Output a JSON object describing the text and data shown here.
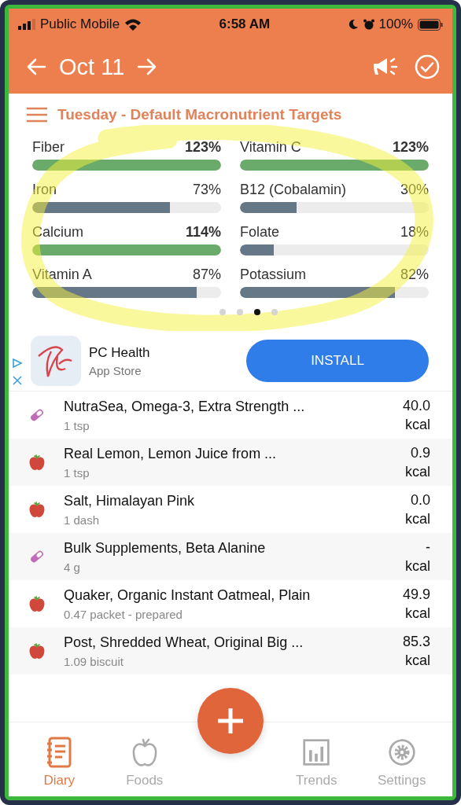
{
  "status_bar": {
    "carrier": "Public Mobile",
    "time": "6:58 AM",
    "battery": "100%"
  },
  "header": {
    "date": "Oct 11"
  },
  "targets_title": "Tuesday - Default Macronutrient Targets",
  "nutrients": [
    {
      "name": "Fiber",
      "percent": "123%",
      "level": 1,
      "met": true
    },
    {
      "name": "Vitamin C",
      "percent": "123%",
      "level": 1,
      "met": true
    },
    {
      "name": "Iron",
      "percent": "73%",
      "level": 0.73,
      "met": false
    },
    {
      "name": "B12 (Cobalamin)",
      "percent": "30%",
      "level": 0.3,
      "met": false
    },
    {
      "name": "Calcium",
      "percent": "114%",
      "level": 1,
      "met": true
    },
    {
      "name": "Folate",
      "percent": "18%",
      "level": 0.18,
      "met": false
    },
    {
      "name": "Vitamin A",
      "percent": "87%",
      "level": 0.87,
      "met": false
    },
    {
      "name": "Potassium",
      "percent": "82%",
      "level": 0.82,
      "met": false
    }
  ],
  "page_dots": [
    {
      "selected": false
    },
    {
      "selected": false
    },
    {
      "selected": true
    },
    {
      "selected": false
    }
  ],
  "ad": {
    "title": "PC Health",
    "subtitle": "App Store",
    "button": "INSTALL"
  },
  "entries": [
    {
      "kind": "supplement",
      "name": "NutraSea, Omega-3, Extra Strength ...",
      "amount": "1 tsp",
      "calories": "40.0",
      "unit": "kcal"
    },
    {
      "kind": "food",
      "name": "Real Lemon, Lemon Juice from ...",
      "amount": "1 tsp",
      "calories": "0.9",
      "unit": "kcal"
    },
    {
      "kind": "food",
      "name": "Salt, Himalayan Pink",
      "amount": "1 dash",
      "calories": "0.0",
      "unit": "kcal"
    },
    {
      "kind": "supplement",
      "name": "Bulk Supplements, Beta Alanine",
      "amount": "4 g",
      "calories": "-",
      "unit": "kcal"
    },
    {
      "kind": "food",
      "name": "Quaker, Organic Instant Oatmeal, Plain",
      "amount": "0.47 packet - prepared",
      "calories": "49.9",
      "unit": "kcal"
    },
    {
      "kind": "food",
      "name": "Post, Shredded Wheat, Original Big ...",
      "amount": "1.09 biscuit",
      "calories": "85.3",
      "unit": "kcal"
    }
  ],
  "tabs": [
    {
      "label": "Diary",
      "selected": true
    },
    {
      "label": "Foods",
      "selected": false
    },
    {
      "label": "Trends",
      "selected": false
    },
    {
      "label": "Settings",
      "selected": false
    }
  ]
}
